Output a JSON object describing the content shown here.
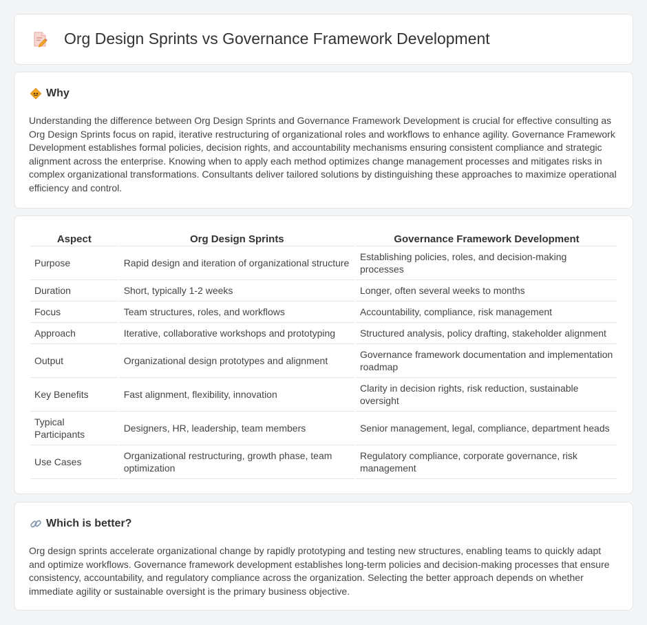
{
  "header": {
    "title": "Org Design Sprints vs Governance Framework Development",
    "icon": "document-edit-icon"
  },
  "why": {
    "title": "Why",
    "icon": "diamond-sign-icon",
    "text": "Understanding the difference between Org Design Sprints and Governance Framework Development is crucial for effective consulting as Org Design Sprints focus on rapid, iterative restructuring of organizational roles and workflows to enhance agility. Governance Framework Development establishes formal policies, decision rights, and accountability mechanisms ensuring consistent compliance and strategic alignment across the enterprise. Knowing when to apply each method optimizes change management processes and mitigates risks in complex organizational transformations. Consultants deliver tailored solutions by distinguishing these approaches to maximize operational efficiency and control."
  },
  "table": {
    "headers": [
      "Aspect",
      "Org Design Sprints",
      "Governance Framework Development"
    ],
    "rows": [
      [
        "Purpose",
        "Rapid design and iteration of organizational structure",
        "Establishing policies, roles, and decision-making processes"
      ],
      [
        "Duration",
        "Short, typically 1-2 weeks",
        "Longer, often several weeks to months"
      ],
      [
        "Focus",
        "Team structures, roles, and workflows",
        "Accountability, compliance, risk management"
      ],
      [
        "Approach",
        "Iterative, collaborative workshops and prototyping",
        "Structured analysis, policy drafting, stakeholder alignment"
      ],
      [
        "Output",
        "Organizational design prototypes and alignment",
        "Governance framework documentation and implementation roadmap"
      ],
      [
        "Key Benefits",
        "Fast alignment, flexibility, innovation",
        "Clarity in decision rights, risk reduction, sustainable oversight"
      ],
      [
        "Typical Participants",
        "Designers, HR, leadership, team members",
        "Senior management, legal, compliance, department heads"
      ],
      [
        "Use Cases",
        "Organizational restructuring, growth phase, team optimization",
        "Regulatory compliance, corporate governance, risk management"
      ]
    ]
  },
  "better": {
    "title": "Which is better?",
    "icon": "link-icon",
    "text": "Org design sprints accelerate organizational change by rapidly prototyping and testing new structures, enabling teams to quickly adapt and optimize workflows. Governance framework development establishes long-term policies and decision-making processes that ensure consistency, accountability, and regulatory compliance across the organization. Selecting the better approach depends on whether immediate agility or sustainable oversight is the primary business objective."
  },
  "colors": {
    "background": "#f4f5f7",
    "card": "#ffffff",
    "accent_orange": "#f5a623",
    "icon_pink": "#f0a3a0"
  }
}
